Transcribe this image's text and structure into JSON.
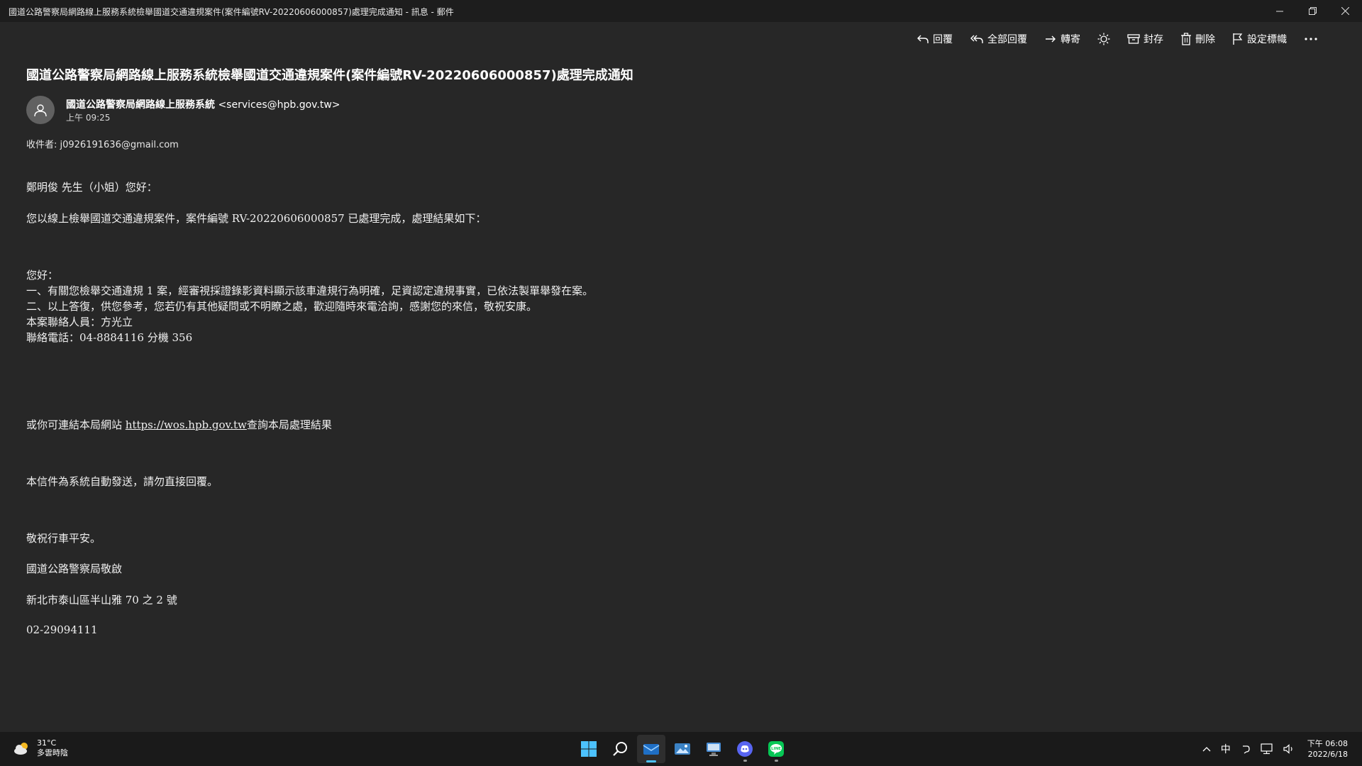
{
  "window": {
    "title": "國道公路警察局網路線上服務系統檢舉國道交通違規案件(案件編號RV-20220606000857)處理完成通知 - 訊息 - 郵件"
  },
  "toolbar": {
    "reply": "回覆",
    "reply_all": "全部回覆",
    "forward": "轉寄",
    "archive": "封存",
    "delete": "刪除",
    "flag": "設定標幟"
  },
  "message": {
    "subject": "國道公路警察局網路線上服務系統檢舉國道交通違規案件(案件編號RV-20220606000857)處理完成通知",
    "sender_name": "國道公路警察局網路線上服務系統",
    "sender_email": "<services@hpb.gov.tw>",
    "time": "上午 09:25",
    "recipients": "收件者: j0926191636@gmail.com",
    "body": {
      "greeting": "鄭明俊 先生（小姐）您好：",
      "intro": "您以線上檢舉國道交通違規案件，案件編號 RV-20220606000857 已處理完成，處理結果如下：",
      "hello": "您好：",
      "item1": "一、有關您檢舉交通違規 1 案，經審視採證錄影資料顯示該車違規行為明確，足資認定違規事實，已依法製單舉發在案。",
      "item2": "二、以上答復，供您參考，您若仍有其他疑問或不明瞭之處，歡迎隨時來電洽詢，感謝您的來信，敬祝安康。",
      "contact_person": "本案聯絡人員：方光立",
      "contact_phone": "聯絡電話：04-8884116 分機 356",
      "link_prefix": "或你可連結本局網站 ",
      "link_url": "https://wos.hpb.gov.tw",
      "link_suffix": "查詢本局處理結果",
      "auto_notice": "本信件為系統自動發送，請勿直接回覆。",
      "wish": "敬祝行車平安。",
      "signature": "國道公路警察局敬啟",
      "address": "新北市泰山區半山雅 70 之 2 號",
      "phone": "02-29094111"
    }
  },
  "taskbar": {
    "weather_temp": "31°C",
    "weather_desc": "多雲時陰",
    "ime": "中",
    "clock_time": "下午 06:08",
    "clock_date": "2022/6/18"
  },
  "icons": {
    "windows": "windows-start-icon",
    "search": "search-icon",
    "mail": "mail-icon",
    "photos": "photos-icon",
    "remote_desktop": "remote-desktop-icon",
    "discord": "discord-icon",
    "line": "line-icon"
  },
  "colors": {
    "background": "#272727",
    "titlebar": "#1d1d1d",
    "taskbar": "#1a1a1a",
    "accent": "#4cc2ff",
    "line_green": "#06c755",
    "discord_blurple": "#5865f2"
  }
}
